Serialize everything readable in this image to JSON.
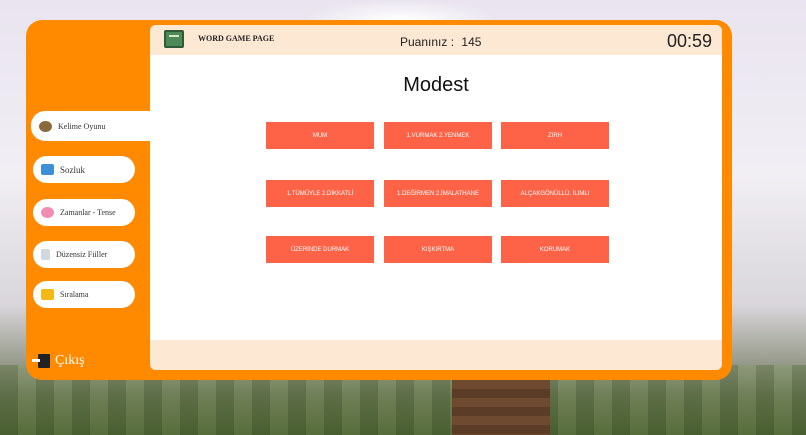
{
  "header": {
    "app_title": "WORD GAME PAGE",
    "score_label": "Puanınız :",
    "score_value": "145",
    "timer": "00:59"
  },
  "sidebar": {
    "items": [
      {
        "label": "Kelime Oyunu",
        "icon": "bicycle-icon"
      },
      {
        "label": "Sozluk",
        "icon": "book-icon"
      },
      {
        "label": "Zamanlar - Tense",
        "icon": "clock-icon"
      },
      {
        "label": "Düzensiz Fiiller",
        "icon": "document-icon"
      },
      {
        "label": "Sıralama",
        "icon": "crown-icon"
      }
    ],
    "exit_label": "Çıkış"
  },
  "game": {
    "word": "Modest",
    "options": [
      "MUM",
      "1.VURMAK 2.YENMEK",
      "ZIRH",
      "1.TÜMÜYLE 2.DİKKATLİ",
      "1.DEĞİRMEN 2.İMALATHANE",
      "ALÇAKGÖNÜLLÜ, İLIMLI",
      "ÜZERİNDE DURMAK",
      "KIŞKIRTMA",
      "KORUMAK"
    ]
  },
  "colors": {
    "frame": "#ff8a00",
    "option_button": "#fe6347",
    "topbar": "#fde8d3"
  }
}
